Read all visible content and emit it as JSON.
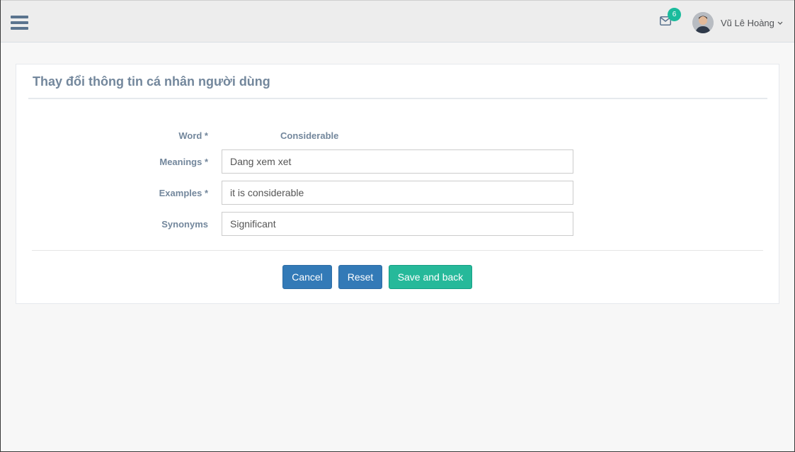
{
  "header": {
    "notification_count": "6",
    "user_name": "Vũ Lê Hoàng"
  },
  "panel": {
    "title": "Thay đổi thông tin cá nhân người dùng"
  },
  "form": {
    "word": {
      "label": "Word *",
      "value": "Considerable"
    },
    "meanings": {
      "label": "Meanings *",
      "value": "Dang xem xet"
    },
    "examples": {
      "label": "Examples *",
      "value": "it is considerable"
    },
    "synonyms": {
      "label": "Synonyms",
      "value": "Significant"
    }
  },
  "buttons": {
    "cancel": "Cancel",
    "reset": "Reset",
    "save": "Save and back"
  },
  "colors": {
    "primary": "#337ab7",
    "success": "#26b99a",
    "badge": "#1abb9c",
    "muted_text": "#73879c"
  },
  "icons": {
    "menu": "hamburger-icon",
    "mail": "envelope-icon",
    "dropdown": "chevron-down-icon"
  }
}
